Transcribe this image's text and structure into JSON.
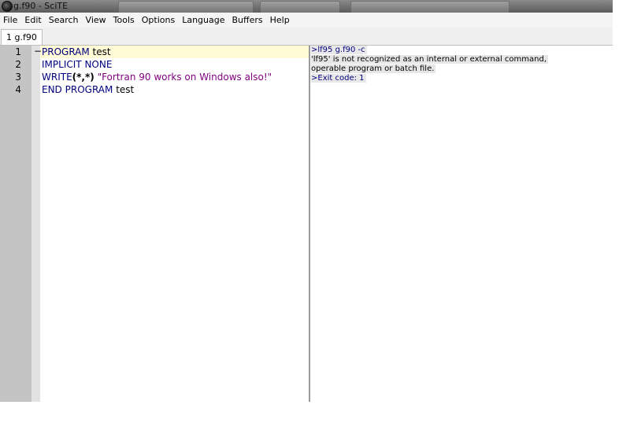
{
  "window": {
    "title": "g.f90 - SciTE"
  },
  "menu": [
    "File",
    "Edit",
    "Search",
    "View",
    "Tools",
    "Options",
    "Language",
    "Buffers",
    "Help"
  ],
  "tabs": [
    {
      "label": "1 g.f90"
    }
  ],
  "editor": {
    "lines": [
      {
        "number": "1",
        "fold": "−",
        "tokens": [
          {
            "text": "PROGRAM",
            "cls": "kw"
          },
          {
            "text": " test",
            "cls": "plain"
          }
        ]
      },
      {
        "number": "2",
        "fold": "",
        "tokens": [
          {
            "text": "IMPLICIT",
            "cls": "kw"
          },
          {
            "text": " ",
            "cls": "plain"
          },
          {
            "text": "NONE",
            "cls": "kw"
          }
        ]
      },
      {
        "number": "3",
        "fold": "",
        "tokens": [
          {
            "text": "WRITE",
            "cls": "kw"
          },
          {
            "text": "(*,*)",
            "cls": "op"
          },
          {
            "text": " ",
            "cls": "plain"
          },
          {
            "text": "\"Fortran 90 works on Windows also!\"",
            "cls": "str"
          }
        ]
      },
      {
        "number": "4",
        "fold": "",
        "tokens": [
          {
            "text": "END",
            "cls": "kw"
          },
          {
            "text": " ",
            "cls": "plain"
          },
          {
            "text": "PROGRAM",
            "cls": "kw"
          },
          {
            "text": " test",
            "cls": "plain"
          }
        ]
      }
    ]
  },
  "output": {
    "lines": [
      {
        "text": ">lf95 g.f90 -c",
        "kind": "cmd"
      },
      {
        "text": "'lf95' is not recognized as an internal or external command,",
        "kind": "err"
      },
      {
        "text": "operable program or batch file.",
        "kind": "err"
      },
      {
        "text": ">Exit code: 1",
        "kind": "exit"
      }
    ]
  },
  "colors": {
    "keyword": "#00007f",
    "string": "#7f007f",
    "gutter": "#c4c4c4",
    "current_line": "#fffbd6"
  }
}
